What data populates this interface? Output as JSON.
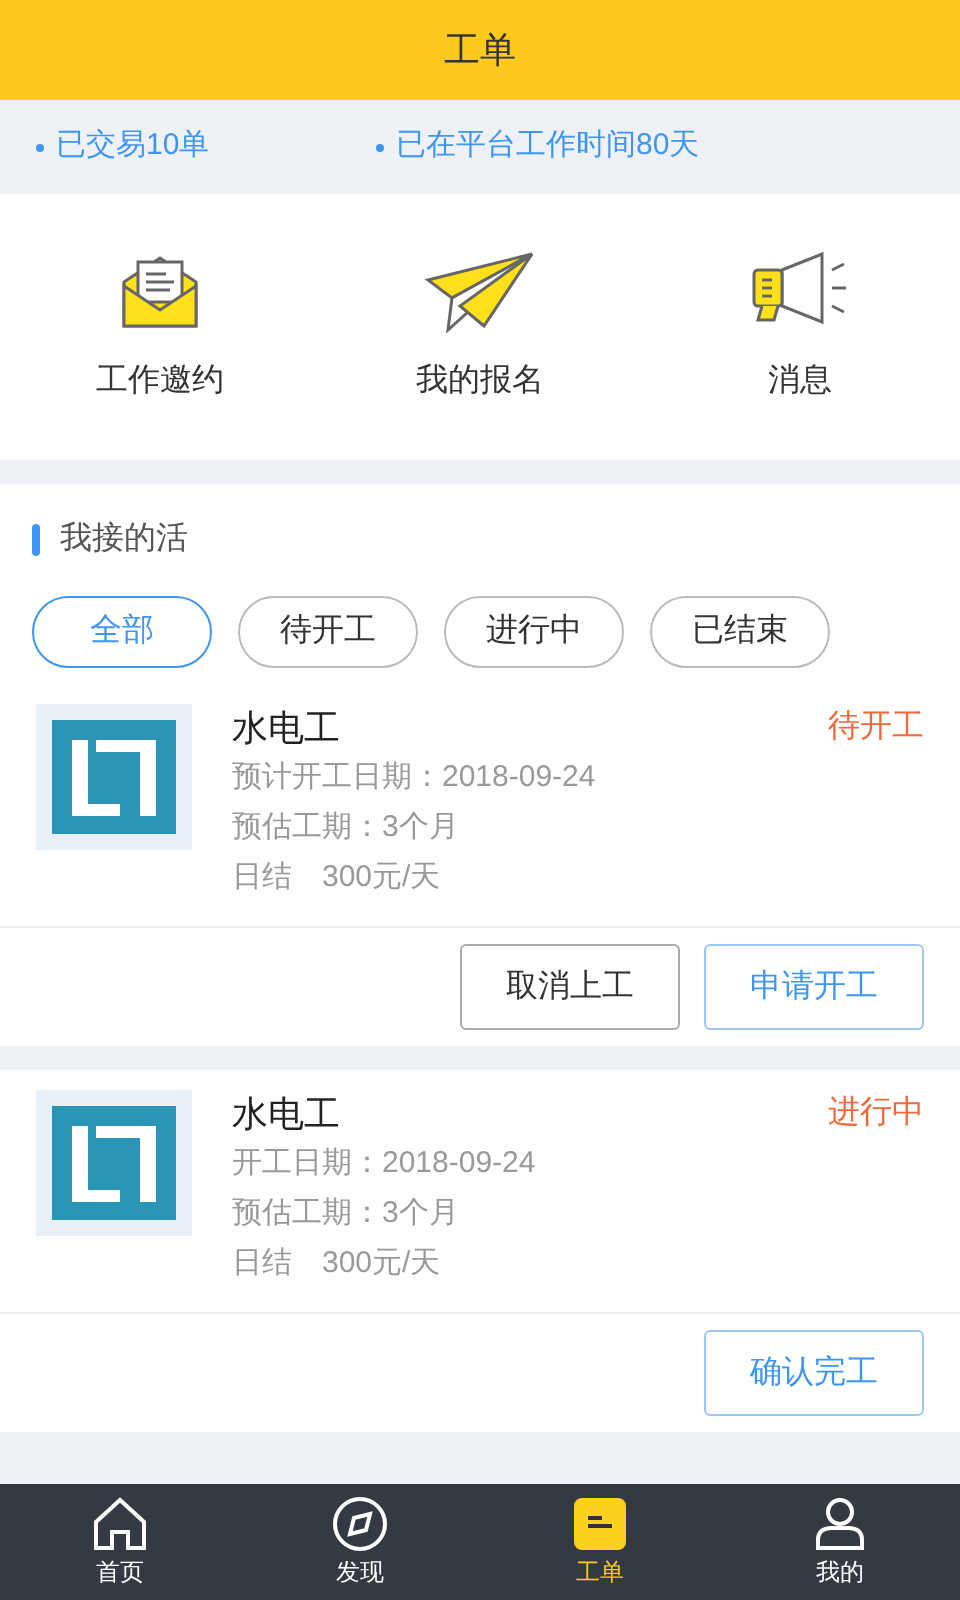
{
  "header": {
    "title": "工单"
  },
  "stats": [
    "已交易10单",
    "已在平台工作时间80天"
  ],
  "quick_menu": [
    {
      "kind": "envelope",
      "label": "工作邀约"
    },
    {
      "kind": "plane",
      "label": "我的报名"
    },
    {
      "kind": "megaphone",
      "label": "消息"
    }
  ],
  "section": {
    "title": "我接的活"
  },
  "filters": [
    {
      "label": "全部",
      "selected": true
    },
    {
      "label": "待开工",
      "selected": false
    },
    {
      "label": "进行中",
      "selected": false
    },
    {
      "label": "已结束",
      "selected": false
    }
  ],
  "jobs": [
    {
      "title": "水电工",
      "status": "待开工",
      "lines": [
        "预计开工日期：2018-09-24",
        "预估工期：3个月",
        "日结　300元/天"
      ],
      "buttons": [
        {
          "label": "取消上工",
          "kind": "default"
        },
        {
          "label": "申请开工",
          "kind": "primary"
        }
      ]
    },
    {
      "title": "水电工",
      "status": "进行中",
      "lines": [
        "开工日期：2018-09-24",
        "预估工期：3个月",
        "日结　300元/天"
      ],
      "buttons": [
        {
          "label": "确认完工",
          "kind": "primary"
        }
      ]
    }
  ],
  "tab_bar": [
    {
      "kind": "home",
      "label": "首页",
      "selected": false
    },
    {
      "kind": "compass",
      "label": "发现",
      "selected": false
    },
    {
      "kind": "order",
      "label": "工单",
      "selected": true
    },
    {
      "kind": "user",
      "label": "我的",
      "selected": false
    }
  ]
}
